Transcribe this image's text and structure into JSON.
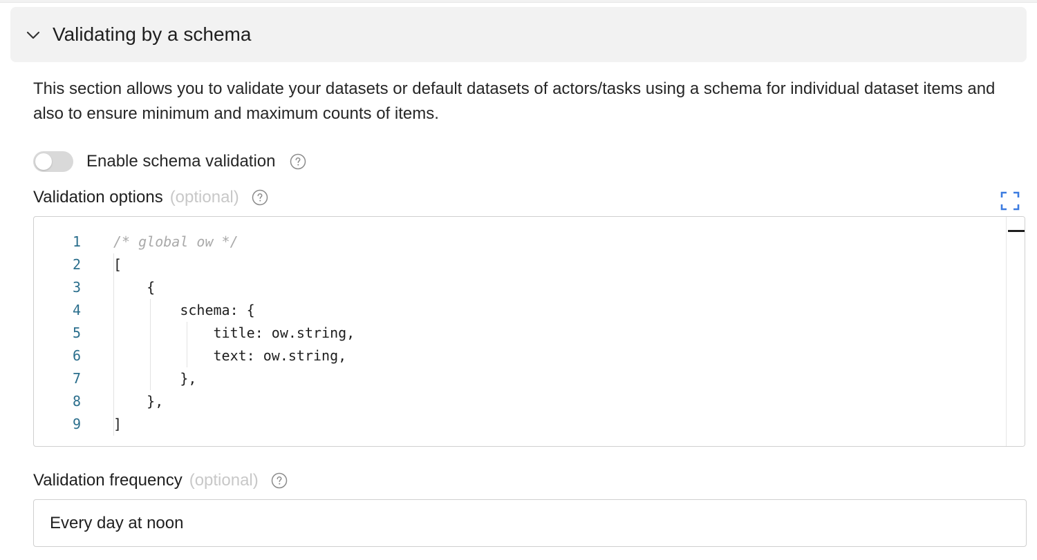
{
  "section": {
    "title": "Validating by a schema",
    "description": "This section allows you to validate your datasets or default datasets of actors/tasks using a schema for individual dataset items and also to ensure minimum and maximum counts of items."
  },
  "toggle": {
    "label": "Enable schema validation",
    "enabled": false
  },
  "validation_options": {
    "label": "Validation options",
    "optional_label": "(optional)",
    "code_lines": [
      {
        "number": "1",
        "text": "/* global ow */"
      },
      {
        "number": "2",
        "text": "["
      },
      {
        "number": "3",
        "text": "    {"
      },
      {
        "number": "4",
        "text": "        schema: {"
      },
      {
        "number": "5",
        "text": "            title: ow.string,"
      },
      {
        "number": "6",
        "text": "            text: ow.string,"
      },
      {
        "number": "7",
        "text": "        },"
      },
      {
        "number": "8",
        "text": "    },"
      },
      {
        "number": "9",
        "text": "]"
      }
    ]
  },
  "validation_frequency": {
    "label": "Validation frequency",
    "optional_label": "(optional)",
    "value": "Every day at noon"
  },
  "icons": {
    "collapse": "chevron-down-icon",
    "help": "question-circle-icon",
    "fullscreen": "expand-icon"
  },
  "colors": {
    "header_bg": "#f2f2f2",
    "line_number": "#2a6e8c",
    "fullscreen_icon": "#3b7be0",
    "optional_text": "#c8c8c8",
    "toggle_off": "#d9d9d9"
  }
}
